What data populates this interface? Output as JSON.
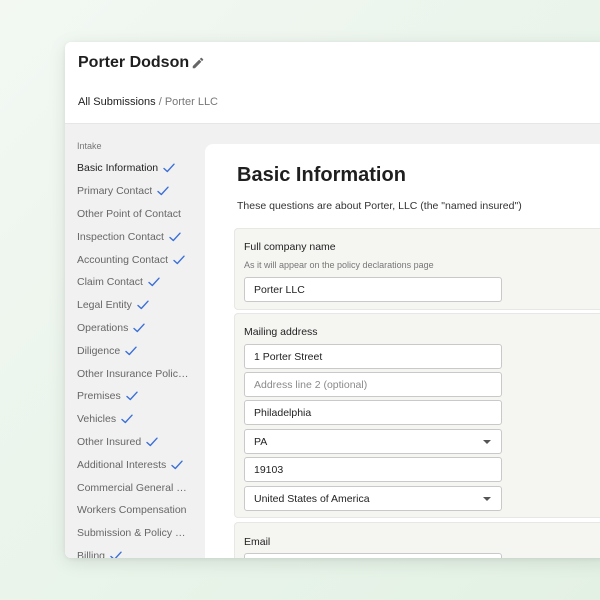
{
  "header": {
    "title": "Porter Dodson",
    "breadcrumb": {
      "root": "All Submissions",
      "separator": " / ",
      "current": "Porter LLC"
    }
  },
  "sidebar": {
    "section_label": "Intake",
    "items": [
      {
        "label": "Basic Information",
        "done": true,
        "active": true
      },
      {
        "label": "Primary Contact",
        "done": true
      },
      {
        "label": "Other Point of Contact",
        "done": false
      },
      {
        "label": "Inspection Contact",
        "done": true
      },
      {
        "label": "Accounting Contact",
        "done": true
      },
      {
        "label": "Claim Contact",
        "done": true
      },
      {
        "label": "Legal Entity",
        "done": true
      },
      {
        "label": "Operations",
        "done": true
      },
      {
        "label": "Diligence",
        "done": true
      },
      {
        "label": "Other Insurance Policies",
        "done": false
      },
      {
        "label": "Premises",
        "done": true
      },
      {
        "label": "Vehicles",
        "done": true
      },
      {
        "label": "Other Insured",
        "done": true
      },
      {
        "label": "Additional Interests",
        "done": true
      },
      {
        "label": "Commercial General Liability",
        "done": false
      },
      {
        "label": "Workers Compensation",
        "done": false
      },
      {
        "label": "Submission & Policy Details",
        "done": false
      },
      {
        "label": "Billing",
        "done": true
      }
    ]
  },
  "main": {
    "title": "Basic Information",
    "subtitle": "These questions are about Porter, LLC (the \"named insured\")",
    "company": {
      "label": "Full company name",
      "help": "As it will appear on the policy declarations page",
      "value": "Porter LLC"
    },
    "mailing": {
      "label": "Mailing address",
      "line1": "1 Porter Street",
      "line2_placeholder": "Address line 2 (optional)",
      "city": "Philadelphia",
      "state": "PA",
      "zip": "19103",
      "country": "United States of America"
    },
    "email": {
      "label": "Email"
    }
  },
  "colors": {
    "accent": "#3b6fd8",
    "sidebar_bg": "#f1f1f1",
    "card_bg": "#f5f5f2"
  }
}
